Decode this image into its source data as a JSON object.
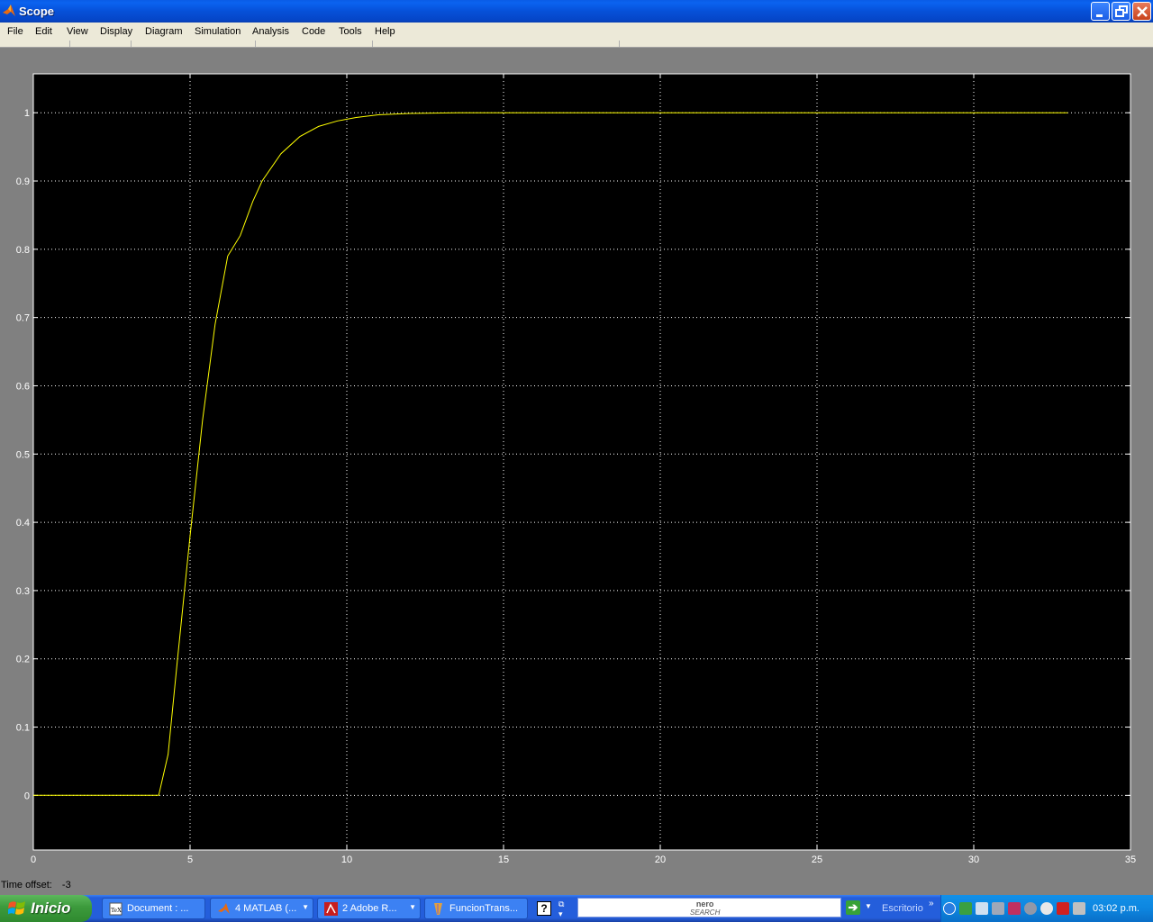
{
  "window": {
    "title": "Scope",
    "menu": [
      "File",
      "Edit",
      "View",
      "Display",
      "Diagram",
      "Simulation",
      "Analysis",
      "Code",
      "Tools",
      "Help"
    ]
  },
  "chart_data": {
    "type": "line",
    "title": "",
    "xlabel": "",
    "ylabel": "",
    "xlim": [
      0,
      35
    ],
    "ylim": [
      -0.08,
      1.057
    ],
    "xticks": [
      0,
      5,
      10,
      15,
      20,
      25,
      30,
      35
    ],
    "yticks": [
      0,
      0.1,
      0.2,
      0.3,
      0.4,
      0.5,
      0.6,
      0.7,
      0.8,
      0.9,
      1
    ],
    "grid": true,
    "background": "#000000",
    "line_color": "#ffff00",
    "series": [
      {
        "x": [
          0,
          4.0,
          4.3,
          4.6,
          5.0,
          5.4,
          5.8,
          6.2,
          6.6,
          7.0,
          7.3,
          7.9,
          8.5,
          9.1,
          9.7,
          10.3,
          11.0,
          12.0,
          13.7,
          33.0
        ],
        "y": [
          0,
          0,
          0.06,
          0.2,
          0.38,
          0.55,
          0.69,
          0.79,
          0.82,
          0.87,
          0.9,
          0.94,
          0.965,
          0.98,
          0.988,
          0.993,
          0.997,
          0.999,
          1.0,
          1.0
        ]
      }
    ]
  },
  "status": {
    "time_offset_label": "Time offset:",
    "time_offset_value": "-3"
  },
  "taskbar": {
    "start_label": "Inicio",
    "tasks": [
      {
        "label": "Document : ...",
        "arrow": false
      },
      {
        "label": "4 MATLAB (...",
        "arrow": true
      },
      {
        "label": "2 Adobe R...",
        "arrow": true
      },
      {
        "label": "FuncionTrans...",
        "arrow": false
      }
    ],
    "search_logo": "nero",
    "search_logo_sub": "SEARCH",
    "desktop_label": "Escritorio",
    "clock": "03:02 p.m."
  },
  "colors": {
    "title_bar": "#0650d8",
    "chart_line": "#ffff00",
    "grid": "#ffffff"
  }
}
